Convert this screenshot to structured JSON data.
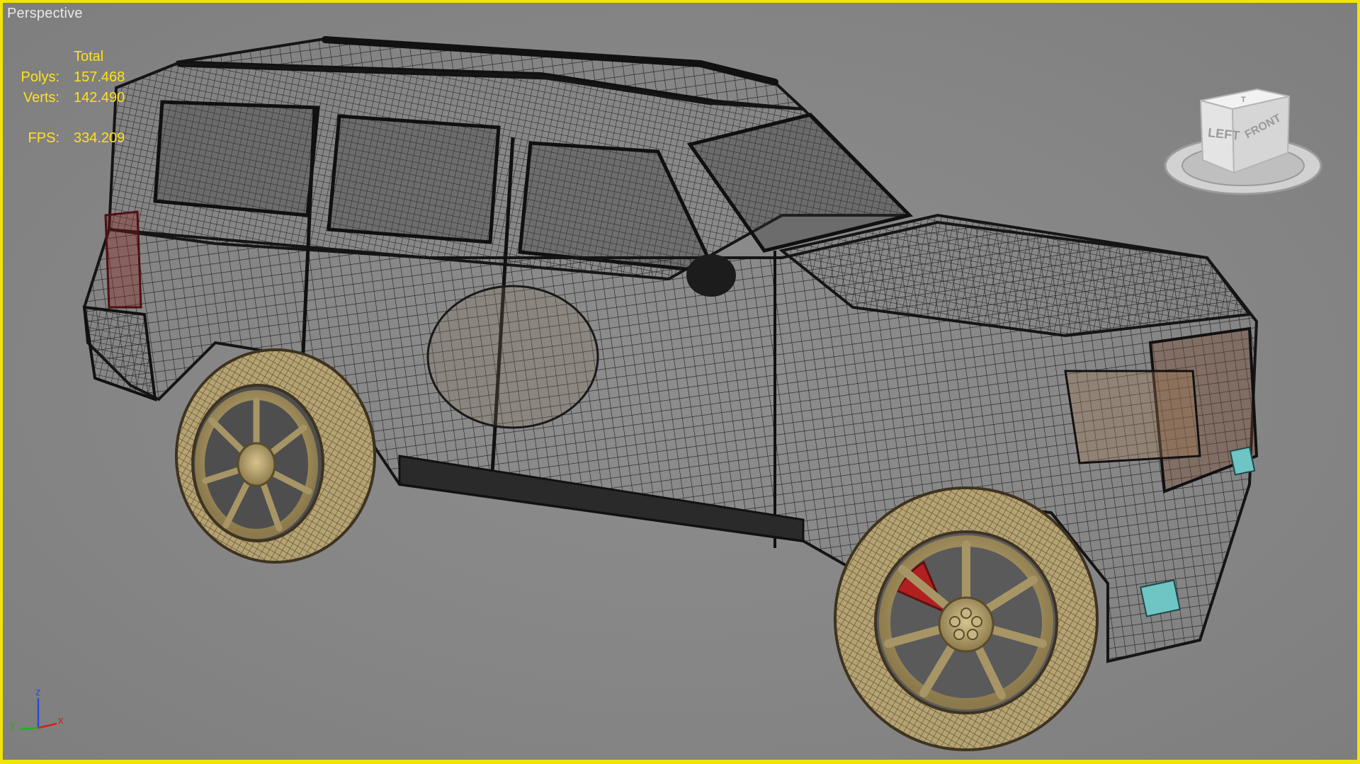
{
  "viewport": {
    "label": "Perspective",
    "border_color": "#f0e40a",
    "background_color": "#858585"
  },
  "stats": {
    "header": "Total",
    "polys_label": "Polys:",
    "polys_value": "157.468",
    "verts_label": "Verts:",
    "verts_value": "142.490",
    "fps_label": "FPS:",
    "fps_value": "334.209",
    "text_color": "#ffe21a"
  },
  "viewcube": {
    "face_left": "LEFT",
    "face_front": "FRONT",
    "face_top": "T"
  },
  "axis_tripod": {
    "x_label": "x",
    "y_label": "y",
    "z_label": "z"
  },
  "model": {
    "description_icon": "wireframe-suv-model",
    "wire_color": "#1c1c1c",
    "tire_color": "#b3a070",
    "caliper_color": "#b02020",
    "light_color": "#6fc4c4"
  }
}
